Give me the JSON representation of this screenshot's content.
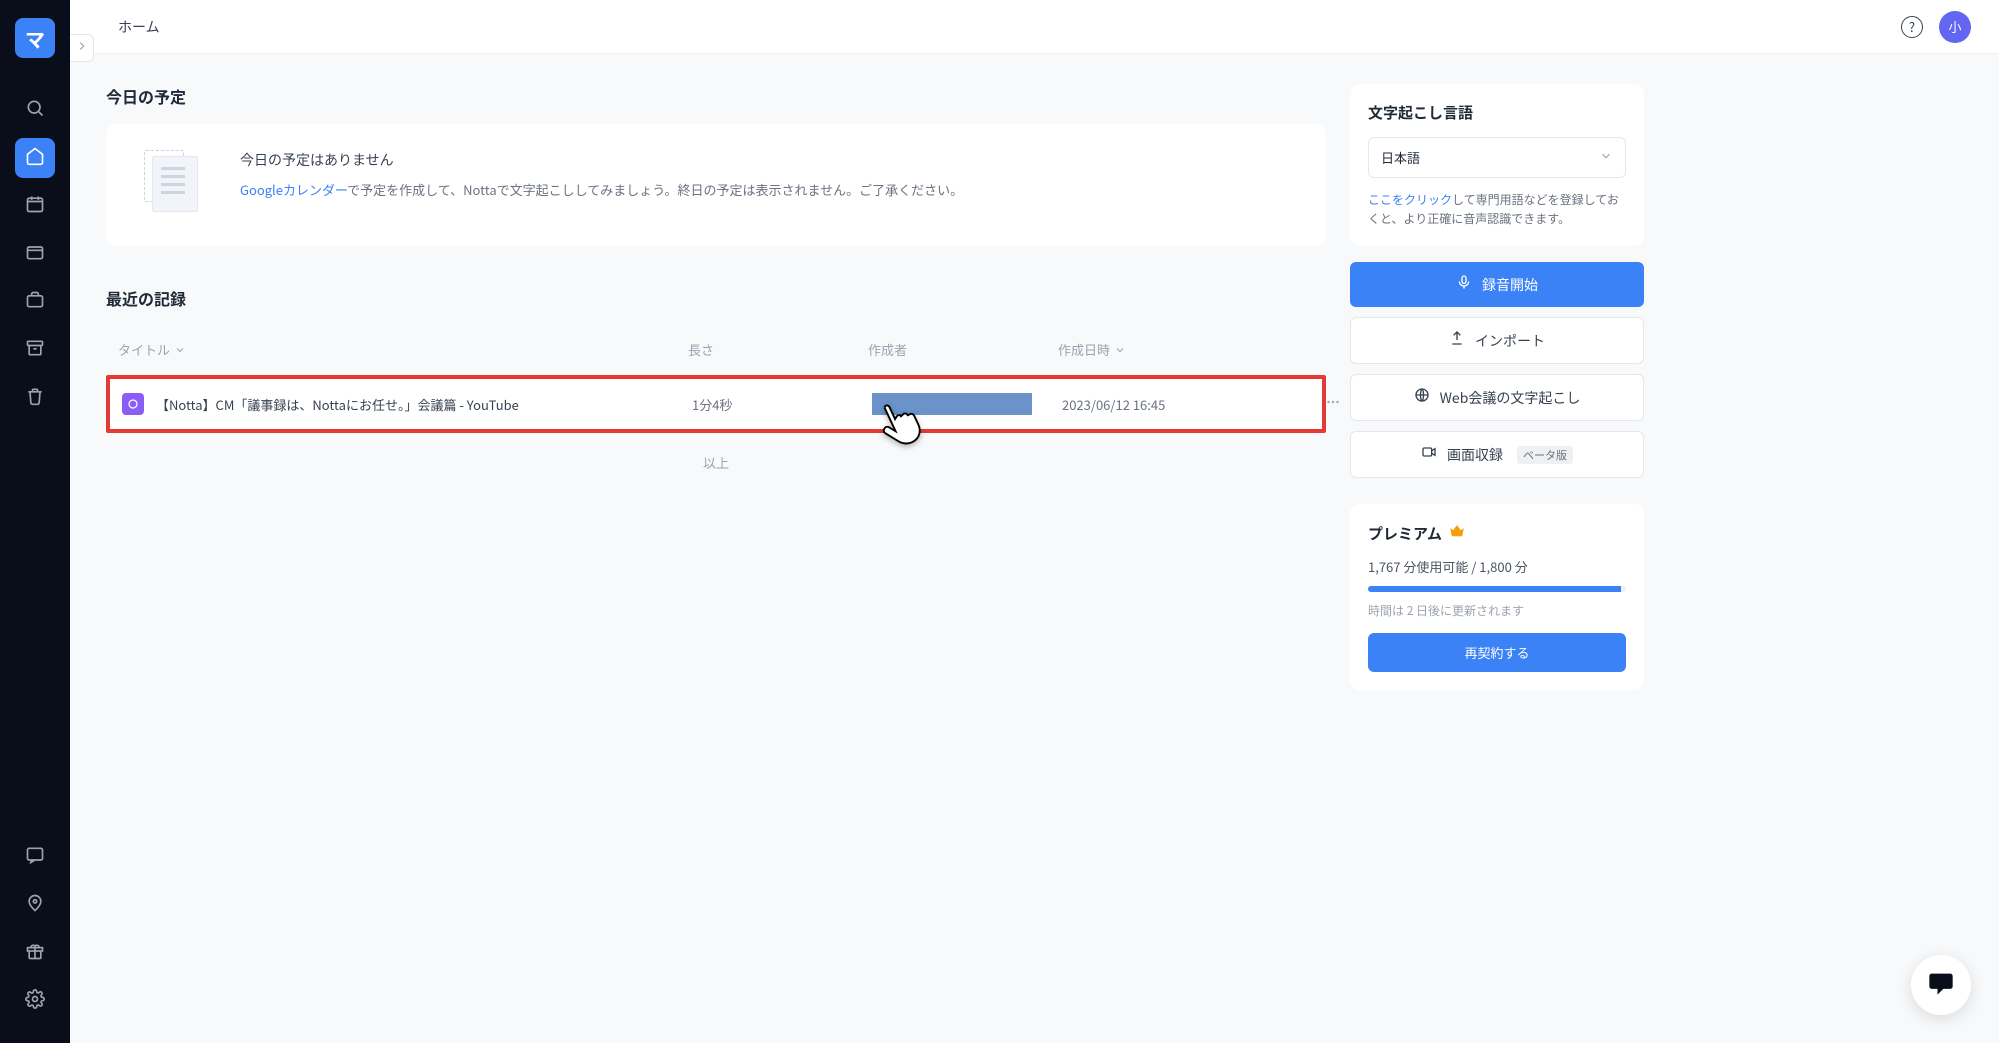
{
  "topbar": {
    "title": "ホーム",
    "avatar_char": "小",
    "help_char": "?"
  },
  "logo_char": "マ",
  "schedule": {
    "section_title": "今日の予定",
    "empty_title": "今日の予定はありません",
    "gcal_link": "Googleカレンダー",
    "empty_desc_rest": "で予定を作成して、Nottaで文字起こししてみましょう。終日の予定は表示されません。ご了承ください。"
  },
  "recent": {
    "section_title": "最近の記録",
    "columns": {
      "title": "タイトル",
      "length": "長さ",
      "author": "作成者",
      "created": "作成日時"
    },
    "rows": [
      {
        "title": "【Notta】CM「議事録は、Nottaにお任せ。」会議篇 - YouTube",
        "length": "1分4秒",
        "created": "2023/06/12 16:45"
      }
    ],
    "end_text": "以上"
  },
  "side_panel": {
    "transcription_title": "文字起こし言語",
    "language": "日本語",
    "hint_link": "ここをクリック",
    "hint_rest": "して専門用語などを登録しておくと、より正確に音声認識できます。",
    "actions": {
      "record": "録音開始",
      "import": "インポート",
      "web_meeting": "Web会議の文字起こし",
      "screen_record": "画面収録",
      "beta": "ベータ版"
    },
    "premium": {
      "title": "プレミアム",
      "usage": "1,767 分使用可能 / 1,800 分",
      "renew_note": "時間は 2 日後に更新されます",
      "renew_btn": "再契約する"
    }
  }
}
